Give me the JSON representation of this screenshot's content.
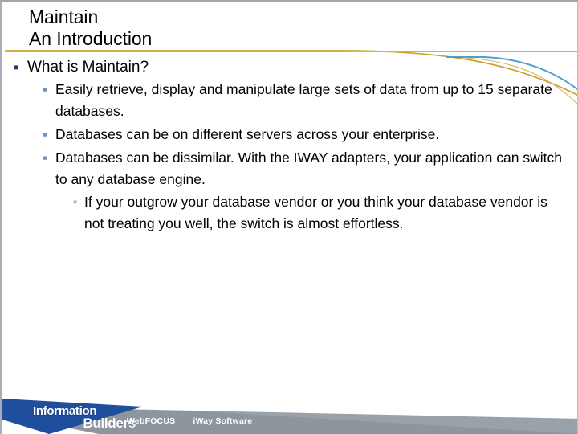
{
  "slide": {
    "title_lines": [
      "Maintain",
      "An Introduction"
    ],
    "accent_rule_color": "#cbb45f",
    "bullet_level1_color": "#1b3a6b",
    "bullet_level2_color": "#7090b4",
    "bullet_level3_color": "#9fb4c9",
    "bullet_glyph": "▪"
  },
  "content": {
    "items": [
      {
        "level": 1,
        "text": "What is Maintain?"
      },
      {
        "level": 2,
        "text": "Easily retrieve, display and manipulate large sets of data from up to 15 separate databases."
      },
      {
        "level": 2,
        "text": "Databases can be on different servers across your enterprise."
      },
      {
        "level": 2,
        "text": "Databases can be dissimilar.  With the IWAY adapters, your application can switch to any database engine."
      },
      {
        "level": 3,
        "text": "If your outgrow your database vendor or you think your database vendor is not treating you well, the switch is almost effortless."
      }
    ]
  },
  "footer": {
    "logo_line1": "Information",
    "logo_line2": "Builders",
    "brands": [
      "WebFOCUS",
      "iWay Software"
    ],
    "page_number": "",
    "banner_gray": "#9aa2a9",
    "banner_gray_dark": "#8d959d",
    "banner_blue": "#1f4e9c"
  },
  "decoration": {
    "curve_gold": "#c9a227",
    "curve_blue": "#4f9ecb",
    "curve_gold_light": "#d7b860"
  }
}
